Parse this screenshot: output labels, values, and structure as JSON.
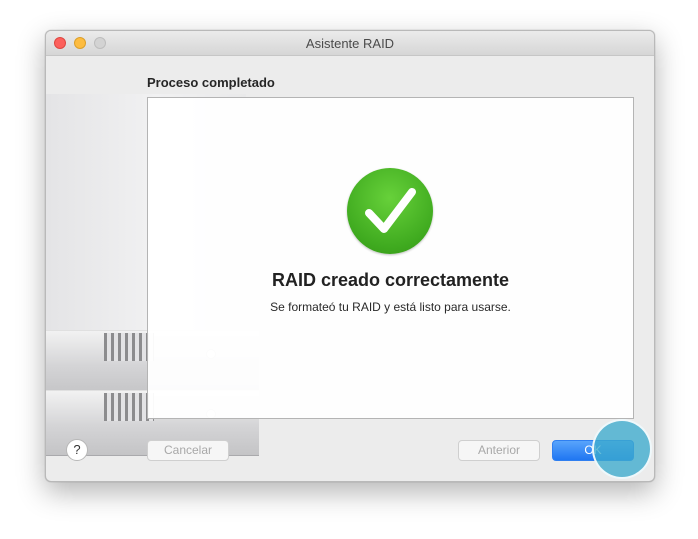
{
  "window": {
    "title": "Asistente RAID"
  },
  "page": {
    "section_heading": "Proceso completado",
    "result_title": "RAID creado correctamente",
    "result_subtitle": "Se formateó tu RAID y está listo para usarse."
  },
  "footer": {
    "help_label": "?",
    "cancel_label": "Cancelar",
    "previous_label": "Anterior",
    "ok_label": "OK"
  },
  "colors": {
    "success": "#4cbb27",
    "accent": "#1f76f2"
  },
  "icons": {
    "status": "checkmark-circle-icon"
  }
}
